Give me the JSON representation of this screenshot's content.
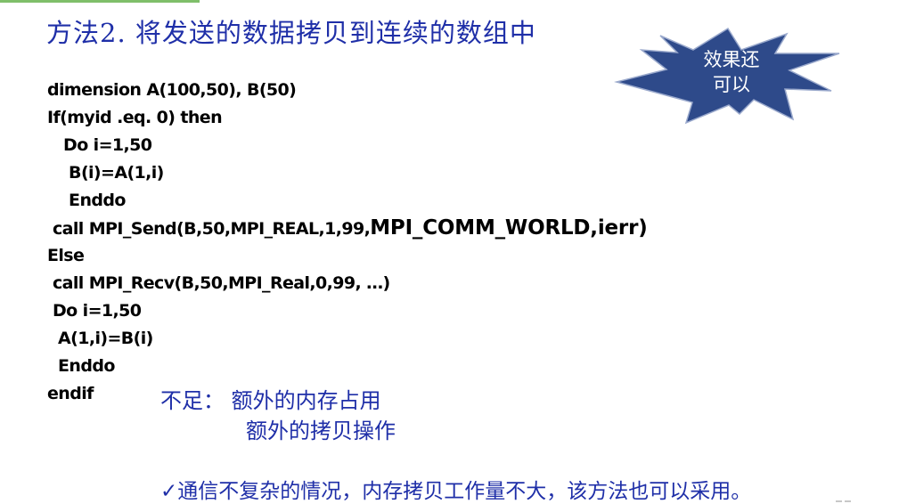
{
  "title": "方法2. 将发送的数据拷贝到连续的数组中",
  "callout": {
    "line1": "效果还",
    "line2": "可以",
    "fill": "#2e4a8a"
  },
  "code_lines": [
    "dimension A(100,50), B(50)",
    "If(myid .eq. 0) then",
    "   Do i=1,50",
    "    B(i)=A(1,i)",
    "    Enddo",
    " call MPI_Send(B,50,MPI_REAL,1,99,",
    "Else",
    " call MPI_Recv(B,50,MPI_Real,0,99, …)",
    " Do i=1,50",
    "  A(1,i)=B(i)",
    "  Enddo",
    "endif"
  ],
  "code_send_tail": "MPI_COMM_WORLD,ierr)",
  "drawbacks": {
    "label": "不足：",
    "item1": "额外的内存占用",
    "item2": "额外的拷贝操作"
  },
  "summary": {
    "check": "✓",
    "text": "通信不复杂的情况，内存拷贝工作量不大，该方法也可以采用。"
  },
  "colors": {
    "title": "#1f2fa8",
    "accent_bar": "#7fbf6a",
    "star": "#2e4a8a"
  }
}
